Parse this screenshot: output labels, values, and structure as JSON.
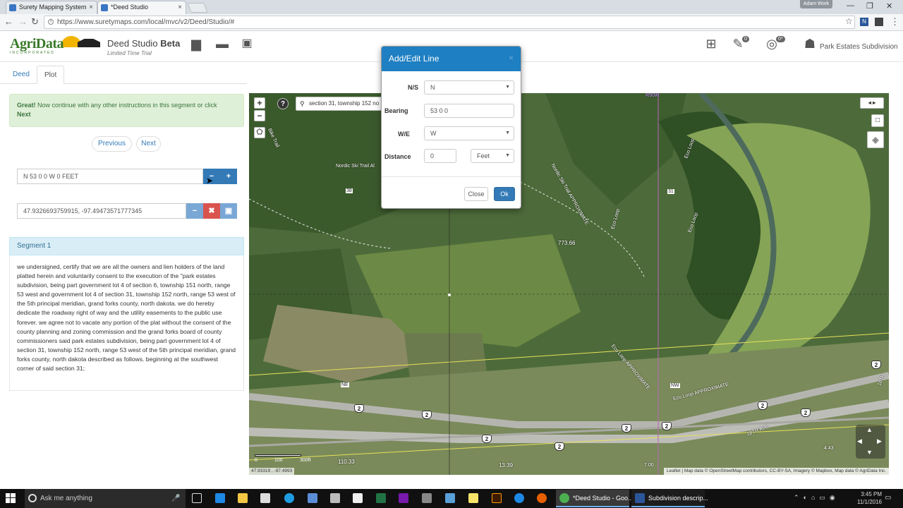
{
  "browser": {
    "tabs": [
      {
        "title": "Surety Mapping System"
      },
      {
        "title": "*Deed Studio"
      }
    ],
    "profile": "Adam Work",
    "url": "https://www.suretymaps.com/local/mvc/v2/Deed/Studio/#"
  },
  "header": {
    "logo_text": "AgriData",
    "logo_sub": "INCORPORATED",
    "title_main": "Deed Studio",
    "title_beta": "Beta",
    "subtitle": "Limited Time Trial",
    "badge1": "0",
    "badge2": "0*",
    "subdivision": "Park Estates Subdivision"
  },
  "tabs": [
    {
      "label": "Deed"
    },
    {
      "label": "Plot"
    }
  ],
  "alert": {
    "strong": "Great!",
    "text": "Now continue with any other instructions in this segment or click",
    "next": "Next"
  },
  "nav": {
    "previous": "Previous",
    "next": "Next"
  },
  "line_field": {
    "value": "N 53  0 0 W 0 FEET"
  },
  "coord_field": {
    "value": "47.9326693759915, -97.49473571777345"
  },
  "segment": {
    "heading": "Segment 1",
    "body": "we undersigned, certify that we are all the owners and lien holders of the land platted herein and voluntarily consent to the execution of the \"park estates subdivision, being part government lot 4 of section 6, township 151 north, range 53 west and government lot 4 of section 31, township 152 north, range 53 west of the 5th principal meridian, grand forks county, north dakota. we do hereby dedicate the roadway right of way and the utility easements to the public use forever. we agree not to vacate any portion of the plat without the consent of the county planning and zoning commission and the grand forks board of county commissioners said park estates subdivision, being part government lot 4 of section 31, township 152 north, range 53 west of the 5th principal meridian, grand forks county, north dakota described as follows. beginning at the southwest corner of said section 31;"
  },
  "map": {
    "search": "section 31, township 152 no",
    "labels": {
      "nordic_ski_trail": "Nordic Ski Trail Al",
      "nordic_ski_trail_approx": "Nordic Ski Trail APPROXIMATE",
      "bike_trail": "Bike Trail",
      "eco_loop1": "Eco Loop",
      "eco_loop2": "Eco Loop",
      "eco_loop3": "Eco Loop",
      "eco_loop_approx": "Eco Loop APPROXIMATE",
      "eco_loop_approx2": "Eco Loop APPROXIMATE",
      "dist_773": "773.66",
      "ave": "18TH AVE",
      "ne": "NE",
      "nw": "NW",
      "r90w": "R90W",
      "dist_110": "110.33",
      "dist_13": "13.39",
      "dist_7": "7.00",
      "dist_443": "4.43",
      "lbl_38": "38",
      "lbl_31": "31",
      "lbl_18th": "18TH"
    },
    "shields": [
      "2",
      "2",
      "2",
      "2",
      "2",
      "2",
      "2",
      "2",
      "2",
      "2"
    ],
    "scale": {
      "s0": "0",
      "s1": "100",
      "s2": "300ft"
    },
    "coords": "47.93319 , -97.4993",
    "attribution": "Leaflet | Map data © OpenStreetMap contributors, CC-BY-SA, Imagery © Mapbox, Map data © AgriData Inc."
  },
  "modal": {
    "title": "Add/Edit Line",
    "ns_label": "N/S",
    "ns_value": "N",
    "bearing_label": "Bearing",
    "bearing_value": "53  0 0",
    "we_label": "W/E",
    "we_value": "W",
    "distance_label": "Distance",
    "distance_value": "0",
    "unit_value": "Feet",
    "close": "Close",
    "ok": "Ok"
  },
  "taskbar": {
    "search": "Ask me anything",
    "app1": "*Deed Studio - Goo...",
    "app2": "Subdivision descrip...",
    "time": "3:45 PM",
    "date": "11/1/2016"
  }
}
